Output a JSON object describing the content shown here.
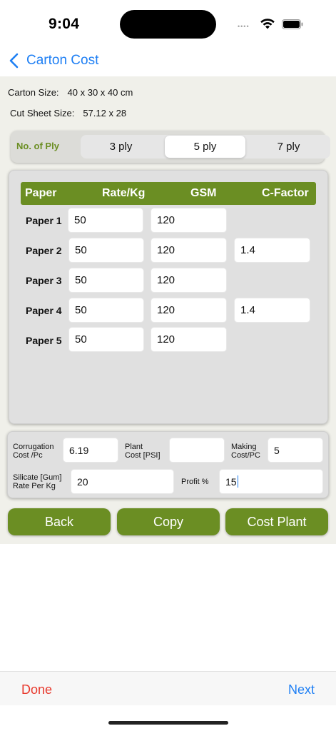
{
  "status": {
    "time": "9:04",
    "signal": "••••"
  },
  "nav": {
    "title": "Carton Cost"
  },
  "info": {
    "carton_size_label": "Carton Size:",
    "carton_size_value": "40 x 30 x 40 cm",
    "cut_sheet_label": "Cut Sheet Size:",
    "cut_sheet_value": "57.12 x 28"
  },
  "ply": {
    "label": "No. of Ply",
    "options": [
      "3 ply",
      "5 ply",
      "7 ply"
    ],
    "selected": "5 ply"
  },
  "paper_table": {
    "headers": [
      "Paper",
      "Rate/Kg",
      "GSM",
      "C-Factor"
    ],
    "rows": [
      {
        "label": "Paper 1",
        "rate": "50",
        "gsm": "120",
        "cfactor": null
      },
      {
        "label": "Paper 2",
        "rate": "50",
        "gsm": "120",
        "cfactor": "1.4"
      },
      {
        "label": "Paper 3",
        "rate": "50",
        "gsm": "120",
        "cfactor": null
      },
      {
        "label": "Paper 4",
        "rate": "50",
        "gsm": "120",
        "cfactor": "1.4"
      },
      {
        "label": "Paper 5",
        "rate": "50",
        "gsm": "120",
        "cfactor": null
      }
    ]
  },
  "costs": {
    "corrugation_label_1": "Corrugation",
    "corrugation_label_2": "Cost /Pc",
    "corrugation_value": "6.19",
    "plant_label_1": "Plant",
    "plant_label_2": "Cost [PSI]",
    "plant_value": "",
    "making_label_1": "Making",
    "making_label_2": "Cost/PC",
    "making_value": "5",
    "silicate_label_1": "Silicate [Gum]",
    "silicate_label_2": "Rate Per Kg",
    "silicate_value": "20",
    "profit_label": "Profit  %",
    "profit_value": "15"
  },
  "actions": {
    "back": "Back",
    "copy": "Copy",
    "cost_plant": "Cost Plant"
  },
  "bottom": {
    "done": "Done",
    "next": "Next"
  },
  "colors": {
    "accent_green": "#6b8e23",
    "ios_blue": "#1e7ff4",
    "done_red": "#e8382c"
  }
}
